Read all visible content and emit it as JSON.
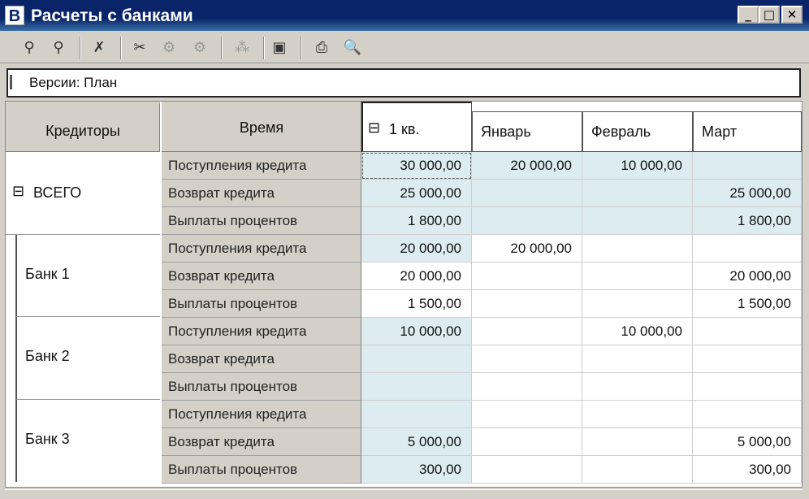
{
  "window": {
    "title": "Расчеты с банками",
    "icon_letter": "В",
    "controls": {
      "minimize": "_",
      "maximize": "□",
      "close": "✕"
    }
  },
  "toolbar": {
    "icons": [
      "filter-icon",
      "filter-clear-icon",
      "cancel-row-icon",
      "drill-icon",
      "expand-icon",
      "collapse-icon",
      "axis-swap-icon",
      "save-icon",
      "print-icon",
      "preview-icon"
    ]
  },
  "version": {
    "label": "Версии: План"
  },
  "grid": {
    "corner": {
      "creditors": "Кредиторы",
      "time": "Время"
    },
    "columns": {
      "quarter": "1 кв.",
      "quarter_toggle": "⊟",
      "months": [
        "Январь",
        "Февраль",
        "Март"
      ]
    },
    "groups": [
      {
        "label": "ВСЕГО",
        "toggle": "⊟",
        "rows": [
          {
            "label": "Поступления кредита",
            "values": [
              "30 000,00",
              "20 000,00",
              "10 000,00",
              ""
            ]
          },
          {
            "label": "Возврат кредита",
            "values": [
              "25 000,00",
              "",
              "",
              "25 000,00"
            ]
          },
          {
            "label": "Выплаты процентов",
            "values": [
              "1 800,00",
              "",
              "",
              "1 800,00"
            ]
          }
        ]
      },
      {
        "label": "Банк 1",
        "rows": [
          {
            "label": "Поступления кредита",
            "values": [
              "20 000,00",
              "20 000,00",
              "",
              ""
            ]
          },
          {
            "label": "Возврат кредита",
            "values": [
              "20 000,00",
              "",
              "",
              "20 000,00"
            ]
          },
          {
            "label": "Выплаты процентов",
            "values": [
              "1 500,00",
              "",
              "",
              "1 500,00"
            ]
          }
        ]
      },
      {
        "label": "Банк 2",
        "rows": [
          {
            "label": "Поступления кредита",
            "values": [
              "10 000,00",
              "",
              "10 000,00",
              ""
            ]
          },
          {
            "label": "Возврат кредита",
            "values": [
              "",
              "",
              "",
              ""
            ]
          },
          {
            "label": "Выплаты процентов",
            "values": [
              "",
              "",
              "",
              ""
            ]
          }
        ]
      },
      {
        "label": "Банк 3",
        "rows": [
          {
            "label": "Поступления кредита",
            "values": [
              "",
              "",
              "",
              ""
            ]
          },
          {
            "label": "Возврат кредита",
            "values": [
              "5 000,00",
              "",
              "",
              "5 000,00"
            ]
          },
          {
            "label": "Выплаты процентов",
            "values": [
              "300,00",
              "",
              "",
              "300,00"
            ]
          }
        ]
      }
    ]
  }
}
